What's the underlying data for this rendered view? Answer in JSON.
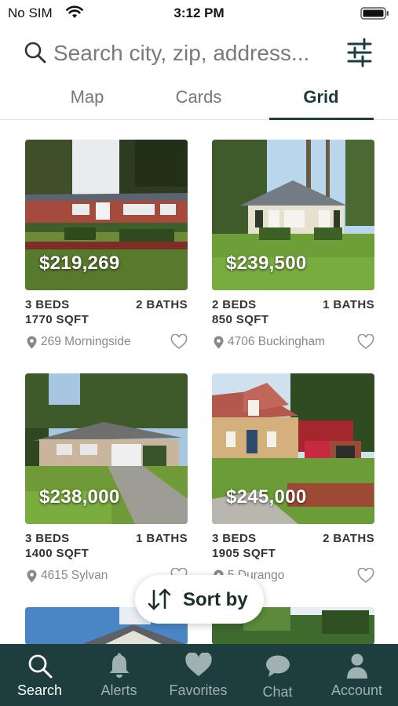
{
  "status_bar": {
    "carrier": "No SIM",
    "time": "3:12 PM"
  },
  "search": {
    "placeholder": "Search city, zip, address..."
  },
  "view_tabs": [
    {
      "label": "Map",
      "active": false
    },
    {
      "label": "Cards",
      "active": false
    },
    {
      "label": "Grid",
      "active": true
    }
  ],
  "listings": [
    {
      "price": "$219,269",
      "beds": "3 BEDS",
      "baths": "2 BATHS",
      "sqft": "1770 SQFT",
      "address": "269 Morningside"
    },
    {
      "price": "$239,500",
      "beds": "2 BEDS",
      "baths": "1 BATHS",
      "sqft": "850 SQFT",
      "address": "4706 Buckingham"
    },
    {
      "price": "$238,000",
      "beds": "3 BEDS",
      "baths": "1 BATHS",
      "sqft": "1400 SQFT",
      "address": "4615 Sylvan"
    },
    {
      "price": "$245,000",
      "beds": "3 BEDS",
      "baths": "2 BATHS",
      "sqft": "1905 SQFT",
      "address": "5 Durango"
    }
  ],
  "sort": {
    "label": "Sort by"
  },
  "tab_bar": [
    {
      "label": "Search",
      "icon": "search-icon",
      "active": true
    },
    {
      "label": "Alerts",
      "icon": "bell-icon",
      "active": false
    },
    {
      "label": "Favorites",
      "icon": "heart-icon",
      "active": false
    },
    {
      "label": "Chat",
      "icon": "chat-bubble-icon",
      "active": false
    },
    {
      "label": "Account",
      "icon": "person-icon",
      "active": false
    }
  ],
  "colors": {
    "accent": "#1d3d3e",
    "tab_inactive": "#9fb1b1",
    "tab_active": "#ffffff"
  }
}
